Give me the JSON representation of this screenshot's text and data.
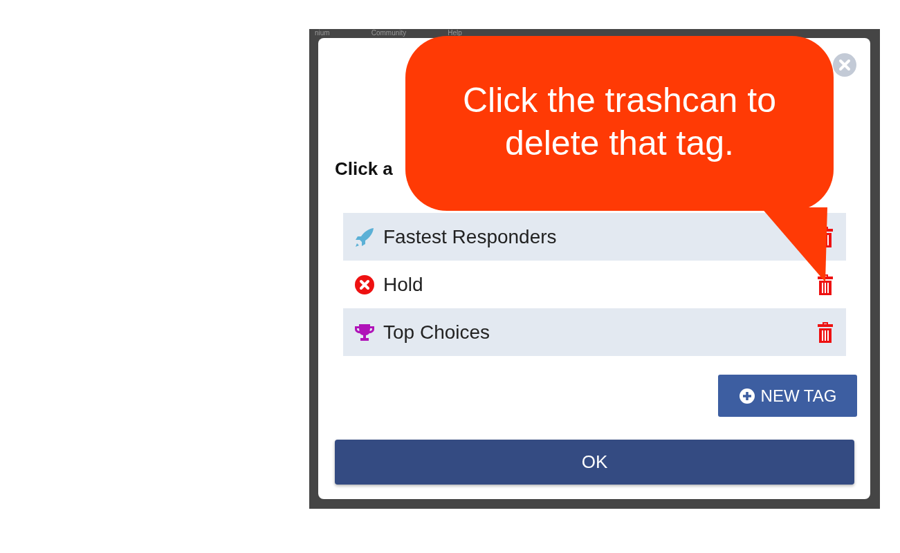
{
  "nav": [
    "nium",
    "Community",
    "Help"
  ],
  "dialog": {
    "heading": "Click a",
    "tags": [
      {
        "label": "Fastest Responders",
        "kind": "rocket",
        "color": "#5bb0d6"
      },
      {
        "label": "Hold",
        "kind": "x-circle",
        "color": "#ee1111"
      },
      {
        "label": "Top Choices",
        "kind": "trophy",
        "color": "#b012b8"
      }
    ],
    "new_tag_button": "NEW TAG",
    "ok_button": "OK"
  },
  "callout": {
    "text": "Click the trashcan to delete that tag."
  }
}
